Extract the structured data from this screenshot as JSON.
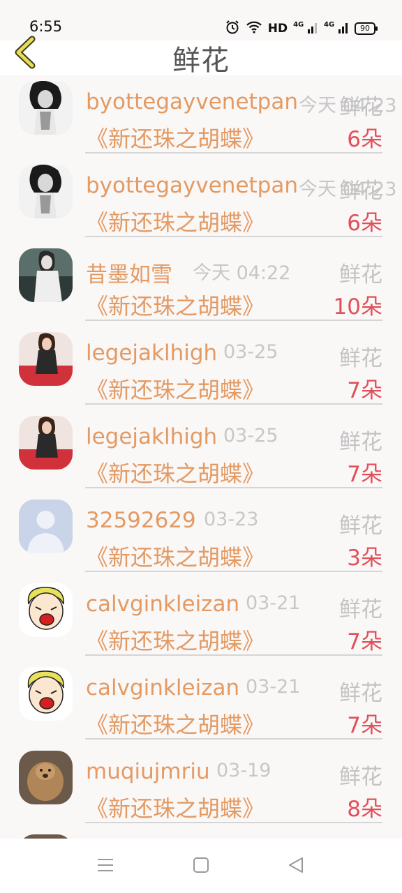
{
  "status_bar": {
    "time": "6:55",
    "hd": "HD",
    "signal1": "4G",
    "signal2": "4G",
    "battery": "90"
  },
  "header": {
    "title": "鲜花",
    "back_icon": "chevron-left-icon"
  },
  "rows": [
    {
      "name": "byottegayvenetpan",
      "date": "今天 04:23",
      "type": "鲜花",
      "book": "《新还珠之胡蝶》",
      "count": "6朵",
      "avatar": "woman-bw-photo"
    },
    {
      "name": "byottegayvenetpan",
      "date": "今天 04:23",
      "type": "鲜花",
      "book": "《新还珠之胡蝶》",
      "count": "6朵",
      "avatar": "woman-bw-photo"
    },
    {
      "name": "昔墨如雪",
      "date": "今天 04:22",
      "type": "鲜花",
      "book": "《新还珠之胡蝶》",
      "count": "10朵",
      "avatar": "woman-teal-photo"
    },
    {
      "name": "legejaklhigh",
      "date": "03-25",
      "type": "鲜花",
      "book": "《新还珠之胡蝶》",
      "count": "7朵",
      "avatar": "woman-red-photo"
    },
    {
      "name": "legejaklhigh",
      "date": "03-25",
      "type": "鲜花",
      "book": "《新还珠之胡蝶》",
      "count": "7朵",
      "avatar": "woman-red-photo"
    },
    {
      "name": "32592629",
      "date": "03-23",
      "type": "鲜花",
      "book": "《新还珠之胡蝶》",
      "count": "3朵",
      "avatar": "default-person"
    },
    {
      "name": "calvginkleizan",
      "date": "03-21",
      "type": "鲜花",
      "book": "《新还珠之胡蝶》",
      "count": "7朵",
      "avatar": "cartoon-face"
    },
    {
      "name": "calvginkleizan",
      "date": "03-21",
      "type": "鲜花",
      "book": "《新还珠之胡蝶》",
      "count": "7朵",
      "avatar": "cartoon-face"
    },
    {
      "name": "muqiujmriu",
      "date": "03-19",
      "type": "鲜花",
      "book": "《新还珠之胡蝶》",
      "count": "8朵",
      "avatar": "animal-photo"
    }
  ],
  "colors": {
    "name": "#e39a63",
    "count": "#e0505a",
    "muted": "#c3c3c3",
    "back_icon": "#e7dd5a"
  },
  "navbar": {
    "menu_icon": "menu-icon",
    "home_icon": "square-icon",
    "back_icon": "triangle-back-icon"
  }
}
